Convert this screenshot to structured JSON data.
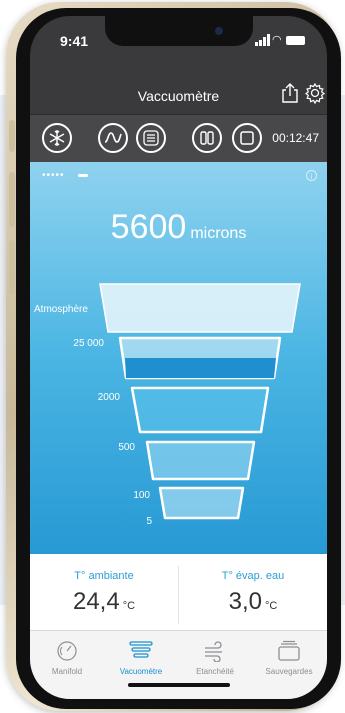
{
  "status": {
    "time": "9:41"
  },
  "header": {
    "title": "Vaccuomètre"
  },
  "toolbar": {
    "timer": "00:12:47"
  },
  "gauge": {
    "value": "5600",
    "unit": "microns",
    "levels": [
      "Atmosphère",
      "25 000",
      "2000",
      "500",
      "100",
      "5"
    ]
  },
  "temps": {
    "ambient_label": "T° ambiante",
    "ambient_value": "24,4",
    "ambient_unit": "°C",
    "evap_label": "T° évap. eau",
    "evap_value": "3,0",
    "evap_unit": "°C"
  },
  "tabs": [
    {
      "label": "Manifold",
      "icon": "gauge-icon"
    },
    {
      "label": "Vacuomètre",
      "icon": "funnel-icon"
    },
    {
      "label": "Etanchéité",
      "icon": "wind-icon"
    },
    {
      "label": "Sauvegardes",
      "icon": "stack-icon"
    }
  ],
  "colors": {
    "accent": "#1a8fd0",
    "vacuum_top": "#8fd2ef",
    "vacuum_bottom": "#2799d4"
  }
}
